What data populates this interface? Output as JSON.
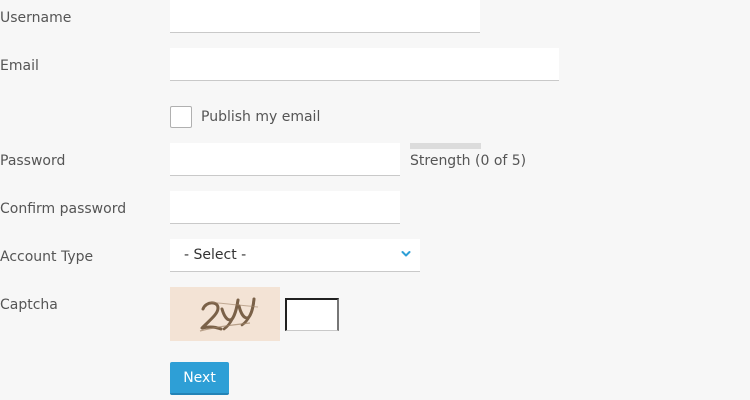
{
  "form": {
    "username": {
      "label": "Username",
      "value": ""
    },
    "email": {
      "label": "Email",
      "value": ""
    },
    "publish_email": {
      "label": "Publish my email",
      "checked": false
    },
    "password": {
      "label": "Password",
      "value": "",
      "strength_text": "Strength (0 of 5)",
      "strength_level": 0
    },
    "confirm_password": {
      "label": "Confirm password",
      "value": ""
    },
    "account_type": {
      "label": "Account Type",
      "selected": "- Select -"
    },
    "captcha": {
      "label": "Captcha",
      "image_text": "2yy",
      "value": ""
    },
    "next_label": "Next"
  },
  "colors": {
    "background": "#f7f7f7",
    "accent": "#2e9fd6",
    "captcha_bg": "#f3e3d5"
  },
  "icons": {
    "select_arrow": "chevron-down-icon"
  }
}
